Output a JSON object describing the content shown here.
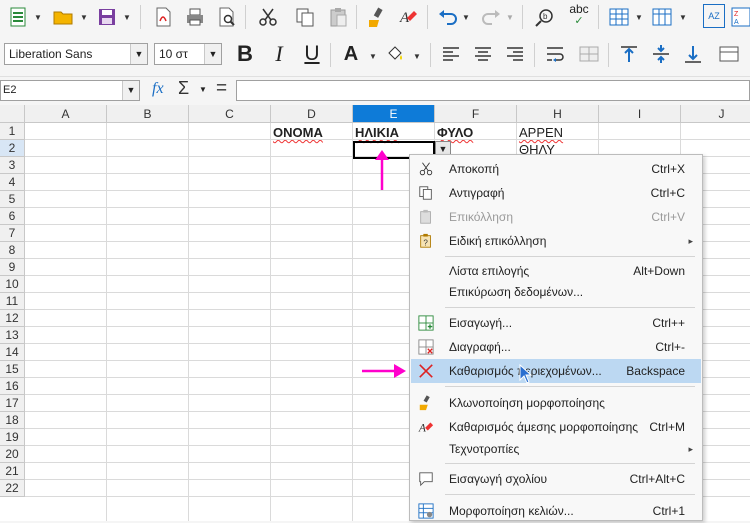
{
  "toolbar1": {
    "icons": [
      "new-spreadsheet-icon",
      "open-folder-icon",
      "save-icon",
      "export-pdf-icon",
      "print-icon",
      "print-preview-icon",
      "cut-icon",
      "copy-icon",
      "paste-icon",
      "clone-formatting-icon",
      "clear-formatting-icon",
      "undo-icon",
      "redo-icon",
      "find-replace-icon",
      "spelling-icon",
      "row-icon",
      "column-icon",
      "sort-icon"
    ],
    "spelling_label": "abc",
    "sort_label": "AZ"
  },
  "toolbar2": {
    "font_name": "Liberation Sans",
    "font_size": "10 στ",
    "bold": "B",
    "italic": "I",
    "underline": "U",
    "font_color_letter": "A"
  },
  "formula_bar": {
    "name_box": "E2",
    "function_wizard": "fx",
    "sum": "Σ",
    "equals": "="
  },
  "grid": {
    "columns": [
      "A",
      "B",
      "C",
      "D",
      "E",
      "F",
      "H",
      "I",
      "J"
    ],
    "rows": [
      "1",
      "2",
      "3",
      "4",
      "5",
      "6",
      "7",
      "8",
      "9",
      "10",
      "11",
      "12",
      "13",
      "14",
      "15",
      "16",
      "17",
      "18",
      "19",
      "20",
      "21",
      "22"
    ],
    "cells": {
      "D1": "ΟΝΟΜΑ",
      "E1": "ΗΛΙΚΙΑ",
      "F1": "ΦΥΛΟ",
      "H1": "ΑΡΡΕΝ",
      "H2": "ΘΗΛΥ"
    }
  },
  "context_menu": {
    "items": [
      {
        "label": "Αποκοπή",
        "shortcut": "Ctrl+X"
      },
      {
        "label": "Αντιγραφή",
        "shortcut": "Ctrl+C"
      },
      {
        "label": "Επικόλληση",
        "shortcut": "Ctrl+V"
      },
      {
        "label": "Ειδική επικόλληση",
        "shortcut": "▸"
      },
      {
        "label": "Λίστα επιλογής",
        "shortcut": "Alt+Down"
      },
      {
        "label": "Επικύρωση δεδομένων...",
        "shortcut": ""
      },
      {
        "label": "Εισαγωγή...",
        "shortcut": "Ctrl++"
      },
      {
        "label": "Διαγραφή...",
        "shortcut": "Ctrl+-"
      },
      {
        "label": "Καθαρισμός περιεχομένων...",
        "shortcut": "Backspace"
      },
      {
        "label": "Κλωνοποίηση μορφοποίησης",
        "shortcut": ""
      },
      {
        "label": "Καθαρισμός άμεσης μορφοποίησης",
        "shortcut": "Ctrl+M"
      },
      {
        "label": "Τεχνοτροπίες",
        "shortcut": "▸"
      },
      {
        "label": "Εισαγωγή σχολίου",
        "shortcut": "Ctrl+Alt+C"
      },
      {
        "label": "Μορφοποίηση κελιών...",
        "shortcut": "Ctrl+1"
      }
    ]
  },
  "colors": {
    "accent": "#0e7bd8",
    "highlight": "#bcd8f2",
    "annotation_arrow": "#ff00cc"
  }
}
